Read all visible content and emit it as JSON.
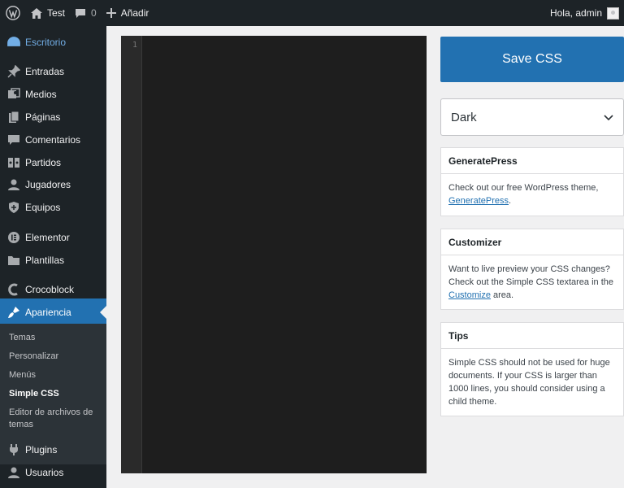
{
  "adminbar": {
    "site_name": "Test",
    "comments_count": "0",
    "new_label": "Añadir",
    "greeting": "Hola, admin"
  },
  "sidebar": {
    "items": [
      {
        "label": "Escritorio",
        "icon": "dashboard-icon"
      },
      {
        "label": "Entradas",
        "icon": "pin-icon"
      },
      {
        "label": "Medios",
        "icon": "media-icon"
      },
      {
        "label": "Páginas",
        "icon": "pages-icon"
      },
      {
        "label": "Comentarios",
        "icon": "comment-icon"
      },
      {
        "label": "Partidos",
        "icon": "matches-icon"
      },
      {
        "label": "Jugadores",
        "icon": "user-icon"
      },
      {
        "label": "Equipos",
        "icon": "shield-icon"
      },
      {
        "label": "Elementor",
        "icon": "elementor-icon"
      },
      {
        "label": "Plantillas",
        "icon": "folder-icon"
      },
      {
        "label": "Crocoblock",
        "icon": "crocoblock-icon"
      },
      {
        "label": "Apariencia",
        "icon": "brush-icon"
      },
      {
        "label": "Plugins",
        "icon": "plugin-icon"
      },
      {
        "label": "Usuarios",
        "icon": "users-icon"
      }
    ],
    "submenu": [
      "Temas",
      "Personalizar",
      "Menús",
      "Simple CSS",
      "Editor de archivos de temas"
    ]
  },
  "editor": {
    "line_number": "1"
  },
  "actions": {
    "save_label": "Save CSS",
    "theme_selected": "Dark"
  },
  "boxes": {
    "generatepress": {
      "title": "GeneratePress",
      "text": "Check out our free WordPress theme,",
      "link": "GeneratePress",
      "after": "."
    },
    "customizer": {
      "title": "Customizer",
      "text": "Want to live preview your CSS changes? Check out the Simple CSS textarea in the",
      "link": "Customize",
      "after": "area."
    },
    "tips": {
      "title": "Tips",
      "text": "Simple CSS should not be used for huge documents. If your CSS is larger than 1000 lines, you should consider using a child theme."
    }
  },
  "colors": {
    "adminbar_bg": "#1d2327",
    "accent": "#2271b1",
    "editor_bg": "#1e1e1e"
  }
}
